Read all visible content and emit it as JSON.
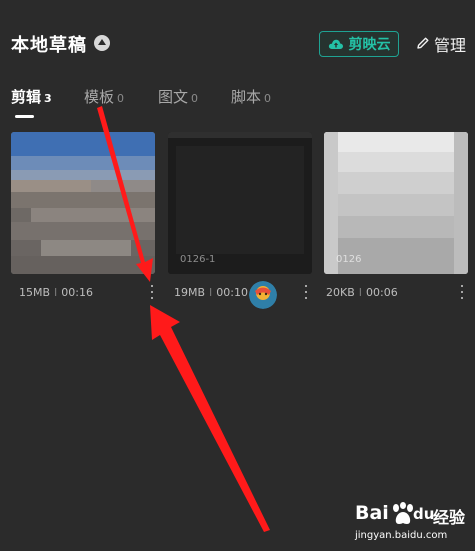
{
  "header": {
    "title": "本地草稿",
    "cloud_button_label": "剪映云",
    "manage_label": "管理"
  },
  "tabs": [
    {
      "label": "剪辑",
      "count": "3"
    },
    {
      "label": "模板",
      "count": "0"
    },
    {
      "label": "图文",
      "count": "0"
    },
    {
      "label": "脚本",
      "count": "0"
    }
  ],
  "drafts": [
    {
      "size": "15MB",
      "duration": "00:16",
      "caption": ""
    },
    {
      "size": "19MB",
      "duration": "00:10",
      "caption": "0126-1"
    },
    {
      "size": "20KB",
      "duration": "00:06",
      "caption": "0126"
    }
  ],
  "separator": "I",
  "watermark": {
    "brand": "Bai",
    "brand_mid": "du",
    "brand_suffix": "经验",
    "url": "jingyan.baidu.com"
  },
  "colors": {
    "background": "#2b2b2b",
    "accent": "#24c1a6",
    "arrow": "#ff1a1a"
  }
}
